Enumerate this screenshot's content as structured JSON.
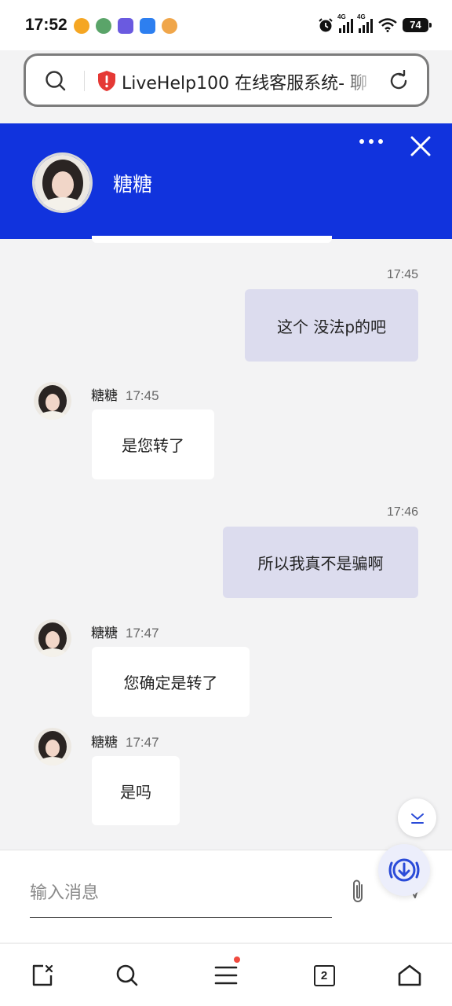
{
  "status_bar": {
    "time": "17:52",
    "network_1": "4G",
    "network_2": "4G",
    "battery": "74"
  },
  "browser": {
    "url_text": "LiveHelp100 在线客服系统- 聊"
  },
  "chat": {
    "agent_name": "糖糖",
    "messages": [
      {
        "from": "me",
        "time": "17:45",
        "text": "这个 没法p的吧"
      },
      {
        "from": "agent",
        "sender": "糖糖",
        "time": "17:45",
        "text": "是您转了"
      },
      {
        "from": "me",
        "time": "17:46",
        "text": "所以我真不是骗啊"
      },
      {
        "from": "agent",
        "sender": "糖糖",
        "time": "17:47",
        "text": "您确定是转了"
      },
      {
        "from": "agent",
        "sender": "糖糖",
        "time": "17:47",
        "text": "是吗"
      }
    ]
  },
  "composer": {
    "placeholder": "输入消息"
  },
  "bottom_nav": {
    "tab_count": "2"
  },
  "colors": {
    "header_blue": "#1133dd",
    "outgoing_bubble": "#dcdcee",
    "incoming_bubble": "#ffffff",
    "background": "#f3f3f4",
    "notification_dot": "#f04a3f"
  }
}
